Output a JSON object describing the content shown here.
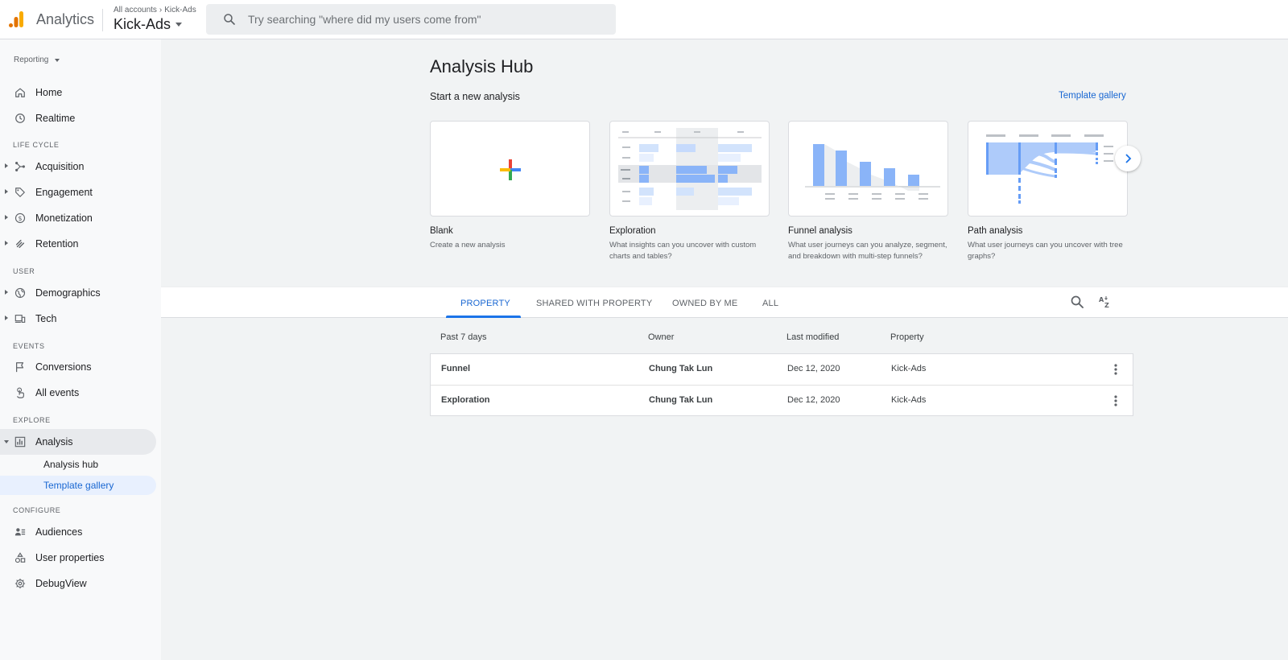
{
  "header": {
    "app_name": "Analytics",
    "crumbs": [
      "All accounts",
      "Kick-Ads"
    ],
    "account": "Kick-Ads",
    "search_placeholder": "Try searching \"where did my users come from\"",
    "logo_colors": [
      "#f9ab00",
      "#e37400"
    ]
  },
  "sidebar": {
    "reporting_label": "Reporting",
    "home": "Home",
    "realtime": "Realtime",
    "section_lifecycle": "LIFE CYCLE",
    "acquisition": "Acquisition",
    "engagement": "Engagement",
    "monetization": "Monetization",
    "retention": "Retention",
    "section_user": "USER",
    "demographics": "Demographics",
    "tech": "Tech",
    "section_events": "EVENTS",
    "conversions": "Conversions",
    "all_events": "All events",
    "section_explore": "EXPLORE",
    "analysis": "Analysis",
    "analysis_hub": "Analysis hub",
    "template_gallery": "Template gallery",
    "section_configure": "CONFIGURE",
    "audiences": "Audiences",
    "user_properties": "User properties",
    "debugview": "DebugView"
  },
  "main": {
    "title": "Analysis Hub",
    "start_label": "Start a new analysis",
    "template_link": "Template gallery",
    "cards": [
      {
        "title": "Blank",
        "desc": "Create a new analysis"
      },
      {
        "title": "Exploration",
        "desc": "What insights can you uncover with custom charts and tables?"
      },
      {
        "title": "Funnel analysis",
        "desc": "What user journeys can you analyze, segment, and breakdown with multi-step funnels?"
      },
      {
        "title": "Path analysis",
        "desc": "What user journeys can you uncover with tree graphs?"
      }
    ],
    "tabs": [
      "PROPERTY",
      "SHARED WITH PROPERTY",
      "OWNED BY ME",
      "ALL"
    ],
    "active_tab": "PROPERTY"
  },
  "table": {
    "headers": [
      "Past 7 days",
      "Owner",
      "Last modified",
      "Property"
    ],
    "rows": [
      {
        "name": "Funnel",
        "owner": "Chung Tak Lun",
        "modified": "Dec 12, 2020",
        "property": "Kick-Ads"
      },
      {
        "name": "Exploration",
        "owner": "Chung Tak Lun",
        "modified": "Dec 12, 2020",
        "property": "Kick-Ads"
      }
    ]
  },
  "colors": {
    "accent": "#1a73e8",
    "link": "#1967d2",
    "chart_blue": "#8ab4f8",
    "chart_blue_dark": "#669df6"
  }
}
